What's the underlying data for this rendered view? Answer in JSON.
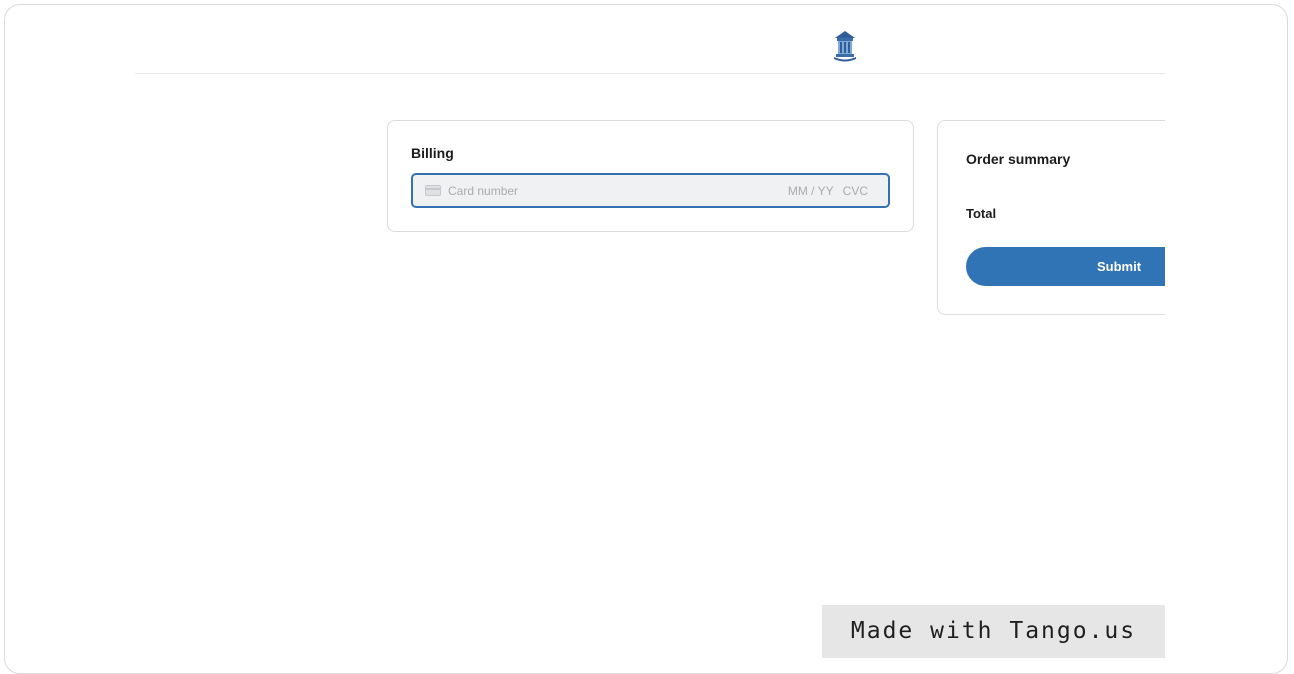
{
  "header": {
    "logo_icon": "library-building-icon"
  },
  "billing": {
    "title": "Billing",
    "card_input": {
      "brand_icon": "credit-card-icon",
      "number_placeholder": "Card number",
      "expiry_placeholder": "MM / YY",
      "cvc_placeholder": "CVC"
    }
  },
  "summary": {
    "title": "Order summary",
    "total_label": "Total",
    "submit_label": "Submit"
  },
  "watermark": {
    "text": "Made with Tango.us"
  },
  "colors": {
    "accent": "#3174b6",
    "input_border": "#3470b2",
    "input_background": "#f0f1f3",
    "badge_background": "#e6e6e6"
  }
}
